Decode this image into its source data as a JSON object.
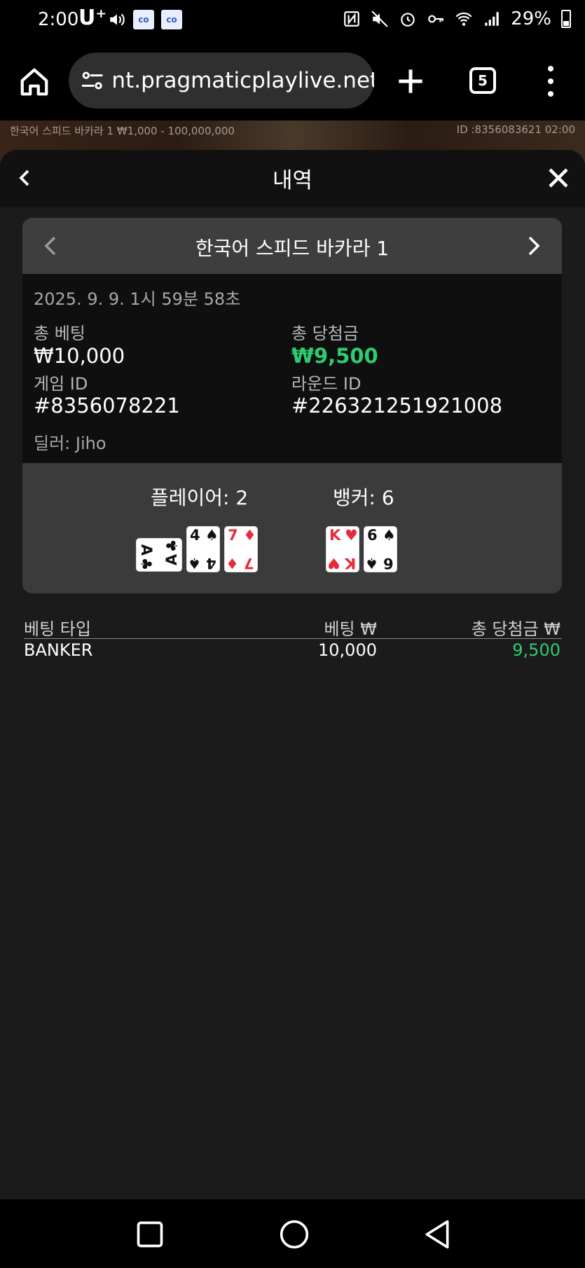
{
  "status_bar": {
    "time": "2:00",
    "carrier": "U⁺",
    "battery": "29%",
    "icons": [
      "volume-icon",
      "app-icon",
      "app-icon",
      "nfc-icon",
      "mute-icon",
      "alarm-icon",
      "key-icon",
      "wifi-icon",
      "signal-icon",
      "battery-icon"
    ]
  },
  "browser": {
    "url": "nt.pragmaticplaylive.net",
    "tab_count": "5"
  },
  "game_bg": {
    "left_text": "한국어 스피드 바카라 1 ₩1,000 - 100,000,000",
    "right_text": "ID :8356083621 02:00"
  },
  "modal": {
    "title": "내역"
  },
  "round": {
    "game_name": "한국어 스피드 바카라 1",
    "datetime": "2025. 9. 9. 1시 59분 58초",
    "total_bet_label": "총 베팅",
    "total_bet_value": "₩10,000",
    "total_win_label": "총 당첨금",
    "total_win_value": "₩9,500",
    "game_id_label": "게임 ID",
    "game_id_value": "#8356078221",
    "round_id_label": "라운드 ID",
    "round_id_value": "#226321251921008",
    "dealer": "딜러: Jiho",
    "player_label": "플레이어: 2",
    "banker_label": "뱅커: 6",
    "player_cards": [
      {
        "rank": "A",
        "suit": "♣",
        "color": "black",
        "sideways": true
      },
      {
        "rank": "4",
        "suit": "♠",
        "color": "black",
        "sideways": false
      },
      {
        "rank": "7",
        "suit": "♦",
        "color": "red",
        "sideways": false
      }
    ],
    "banker_cards": [
      {
        "rank": "K",
        "suit": "♥",
        "color": "red",
        "sideways": false
      },
      {
        "rank": "6",
        "suit": "♠",
        "color": "black",
        "sideways": false
      }
    ]
  },
  "bets_table": {
    "headers": [
      "베팅 타입",
      "베팅 ₩",
      "총 당첨금 ₩"
    ],
    "rows": [
      {
        "type": "BANKER",
        "bet": "10,000",
        "win": "9,500"
      }
    ]
  },
  "colors": {
    "win_green": "#2ecc71",
    "card_red": "#e62b3b"
  }
}
